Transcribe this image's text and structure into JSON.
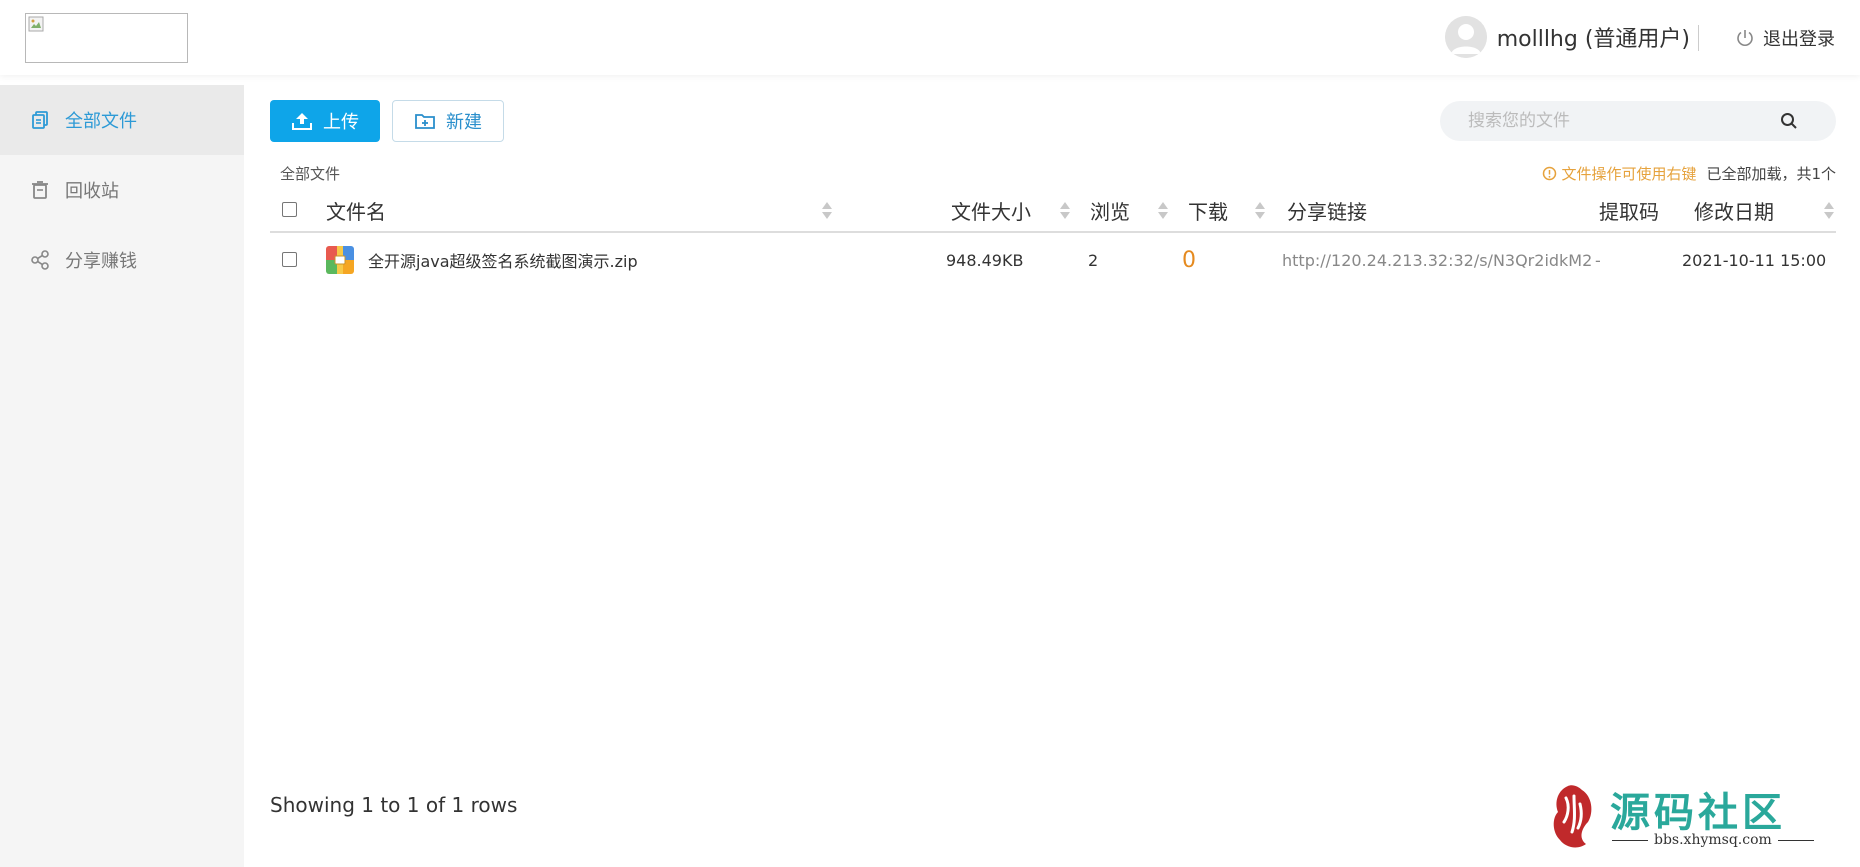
{
  "header": {
    "username": "molllhg (普通用户)",
    "logout_label": "退出登录"
  },
  "sidebar": {
    "items": [
      {
        "label": "全部文件",
        "icon": "files-icon",
        "active": true
      },
      {
        "label": "回收站",
        "icon": "trash-icon",
        "active": false
      },
      {
        "label": "分享赚钱",
        "icon": "share-icon",
        "active": false
      }
    ]
  },
  "toolbar": {
    "upload_label": "上传",
    "new_label": "新建",
    "search_placeholder": "搜索您的文件"
  },
  "breadcrumb": "全部文件",
  "tip": {
    "hint": "文件操作可使用右键",
    "loaded": "已全部加载，共1个"
  },
  "table": {
    "columns": [
      "文件名",
      "文件大小",
      "浏览",
      "下载",
      "分享链接",
      "提取码",
      "修改日期"
    ],
    "rows": [
      {
        "name": "全开源java超级签名系统截图演示.zip",
        "size": "948.49KB",
        "views": "2",
        "downloads": "0",
        "link": "http://120.24.213.32:32/s/N3Qr2idkM2",
        "code": "-",
        "date": "2021-10-11 15:00"
      }
    ]
  },
  "footer": "Showing 1 to 1 of 1 rows",
  "watermark": {
    "title": "源码社区",
    "site": "bbs.xhymsq.com"
  },
  "colors": {
    "accent": "#0ea5e9",
    "link_blue": "#2d9ad6",
    "warning": "#e6a23c",
    "download_orange": "#e58a1f"
  }
}
